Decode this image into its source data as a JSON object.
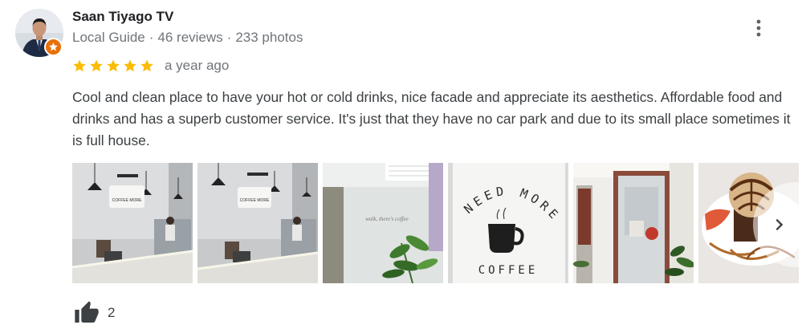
{
  "reviewer": {
    "name": "Saan Tiyago TV",
    "badge": "Local Guide",
    "separator": "·",
    "reviews": "46 reviews",
    "photos": "233 photos",
    "avatar_icon": "person-avatar",
    "badge_icon": "local-guide-star-icon"
  },
  "review": {
    "rating": 5,
    "max_rating": 5,
    "time_ago": "a year ago",
    "text": "Cool and clean place to have your hot or cold drinks, nice facade and appreciate its aesthetics. Affordable food and drinks and has a superb customer service. It's just that they have no car park and due to its small place sometimes it is full house."
  },
  "photos": {
    "count_visible": 6,
    "sign_text": "NEED MORE",
    "sign_text_bottom": "COFFEE",
    "wall_text": "walk, there's coffee",
    "counter_sign": "COFFEE MORE",
    "next_icon": "chevron-right-icon"
  },
  "actions": {
    "like_icon": "thumb-up-icon",
    "like_count": "2",
    "more_icon": "more-vert-icon"
  },
  "colors": {
    "star": "#fbbc04",
    "name": "#202124",
    "secondary": "#70757a",
    "body_text": "#3c4043",
    "badge": "#e8710a"
  }
}
